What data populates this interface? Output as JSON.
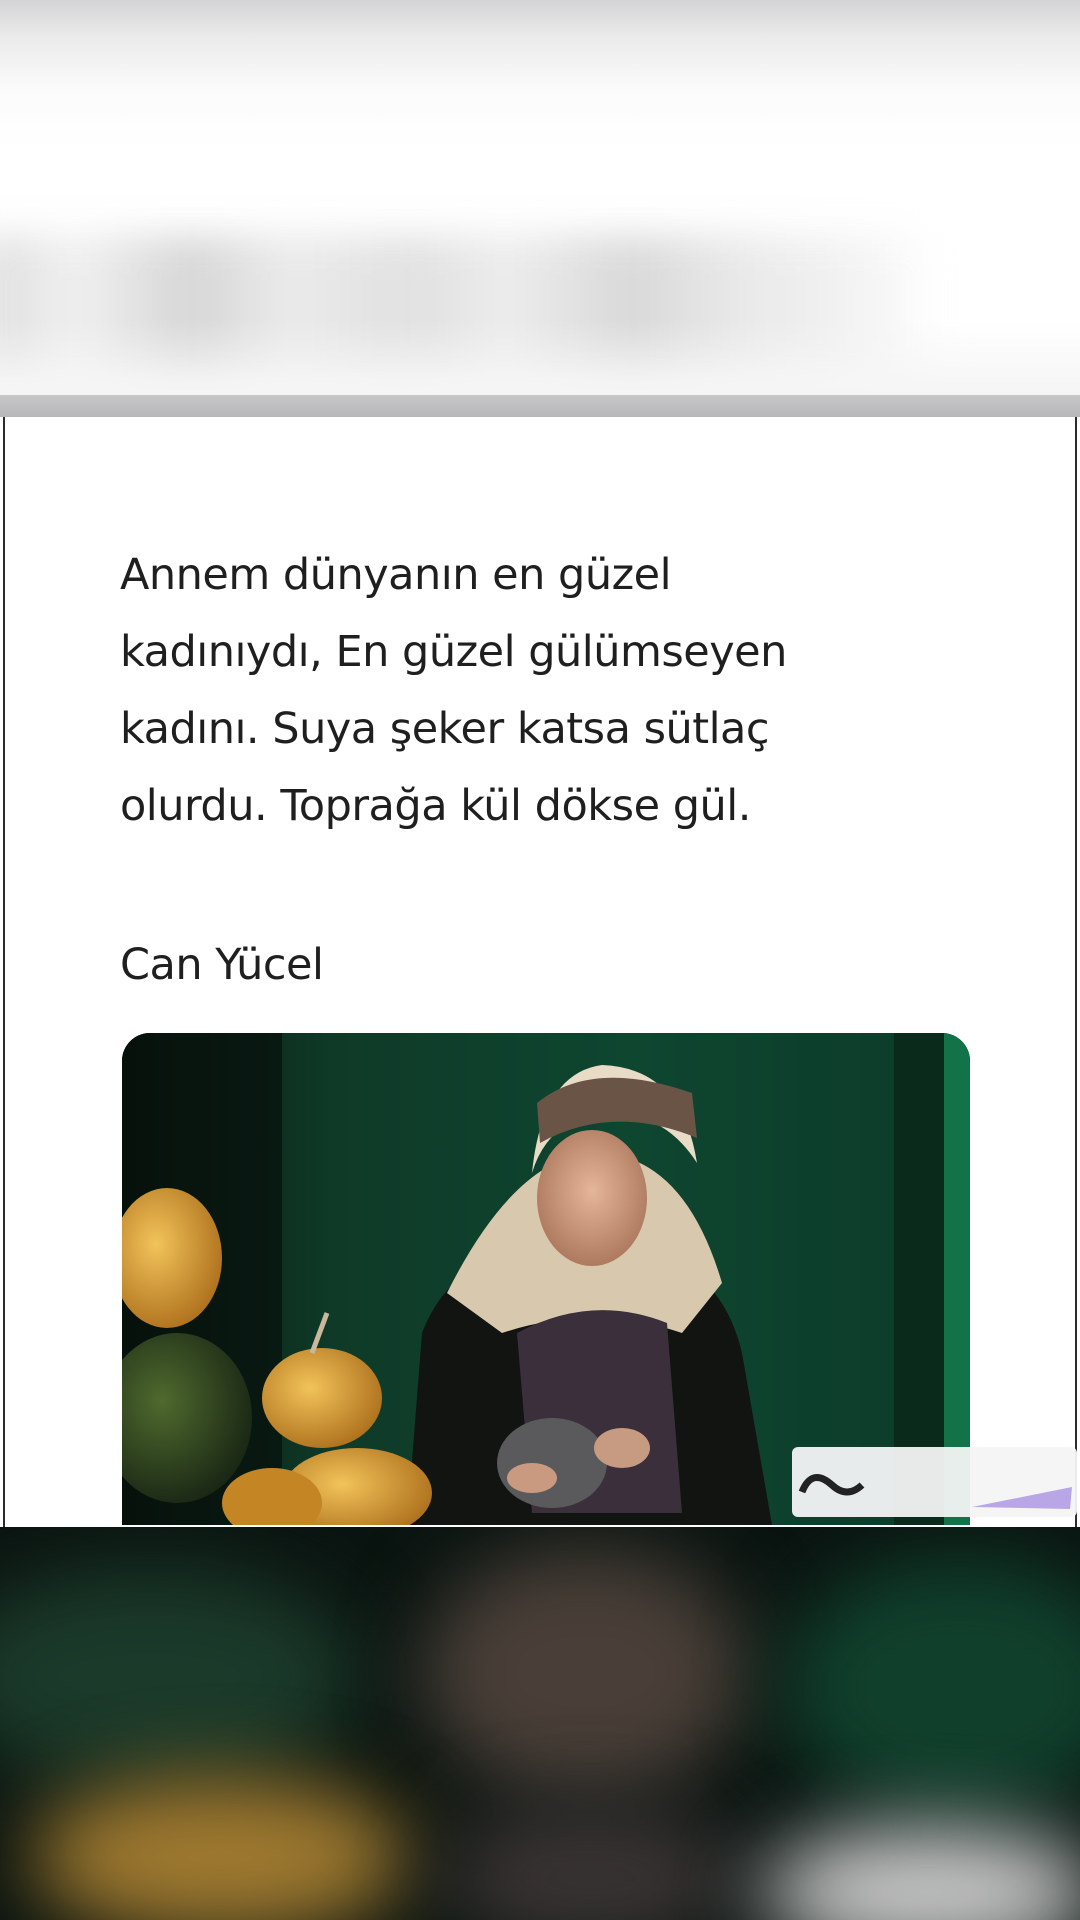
{
  "post": {
    "quote_lines": [
      "Annem dünyanın en güzel",
      "kadınıydı, En güzel gülümseyen",
      "kadını. Suya şeker katsa sütlaç",
      "olurdu. Toprağa kül dökse gül."
    ],
    "author": "Can Yücel"
  },
  "image": {
    "subject": "elderly woman in headscarf with pumpkins",
    "colors": {
      "background": "#0c3a27",
      "headscarf": "#e6d9c2",
      "pumpkin": "#d9a23a"
    }
  },
  "watermark": {
    "icon": "app-logo-icon"
  }
}
